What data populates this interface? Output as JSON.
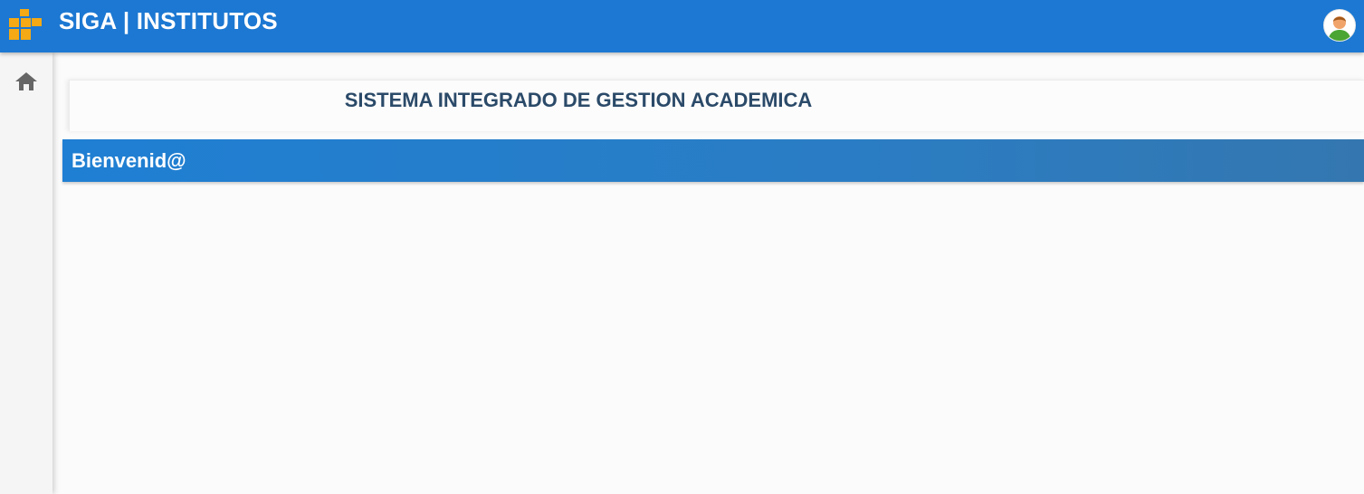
{
  "header": {
    "app_title": "SIGA | INSTITUTOS",
    "logo_icon": "siga-logo-icon",
    "user_icon": "user-avatar-icon",
    "background_color": "#1c78d2",
    "logo_color": "#f4a915"
  },
  "sidebar": {
    "items": [
      {
        "icon": "home-icon"
      }
    ]
  },
  "main": {
    "title": "SISTEMA INTEGRADO DE GESTION ACADEMICA",
    "welcome": "Bienvenid@"
  }
}
